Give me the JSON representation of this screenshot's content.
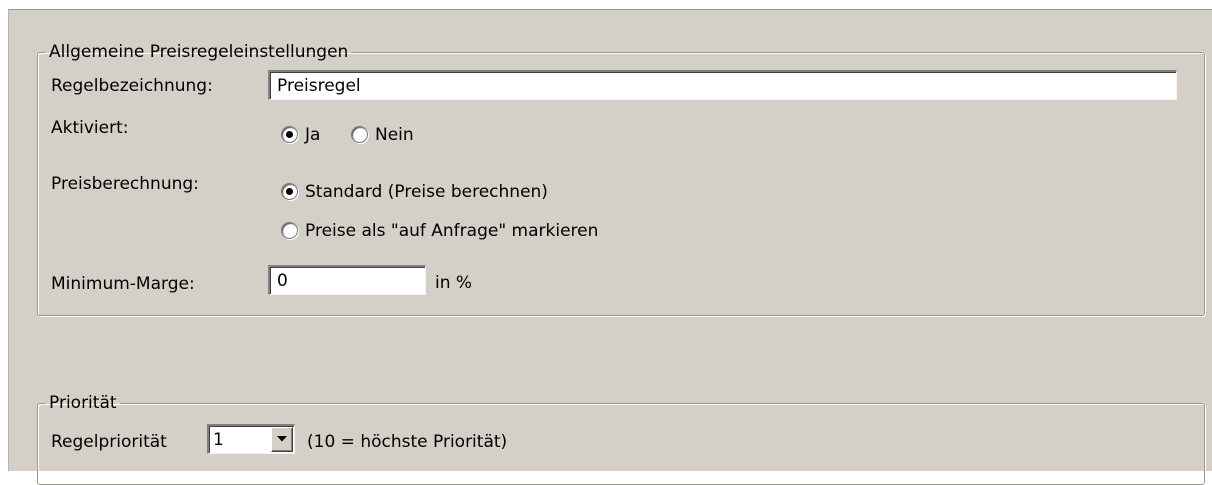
{
  "general": {
    "legend": "Allgemeine Preisregeleinstellungen",
    "rule_name_label": "Regelbezeichnung:",
    "rule_name_value": "Preisregel",
    "activated_label": "Aktiviert:",
    "activated_options": [
      {
        "label": "Ja",
        "checked": true
      },
      {
        "label": "Nein",
        "checked": false
      }
    ],
    "price_calc_label": "Preisberechnung:",
    "price_calc_options": [
      {
        "label": "Standard (Preise berechnen)",
        "checked": true
      },
      {
        "label": "Preise als \"auf Anfrage\" markieren",
        "checked": false
      }
    ],
    "min_margin_label": "Minimum-Marge:",
    "min_margin_value": "0",
    "min_margin_unit": "in %"
  },
  "priority": {
    "legend": "Priorität",
    "label": "Regelpriorität",
    "selected": "1",
    "hint": "(10 = höchste Priorität)"
  }
}
